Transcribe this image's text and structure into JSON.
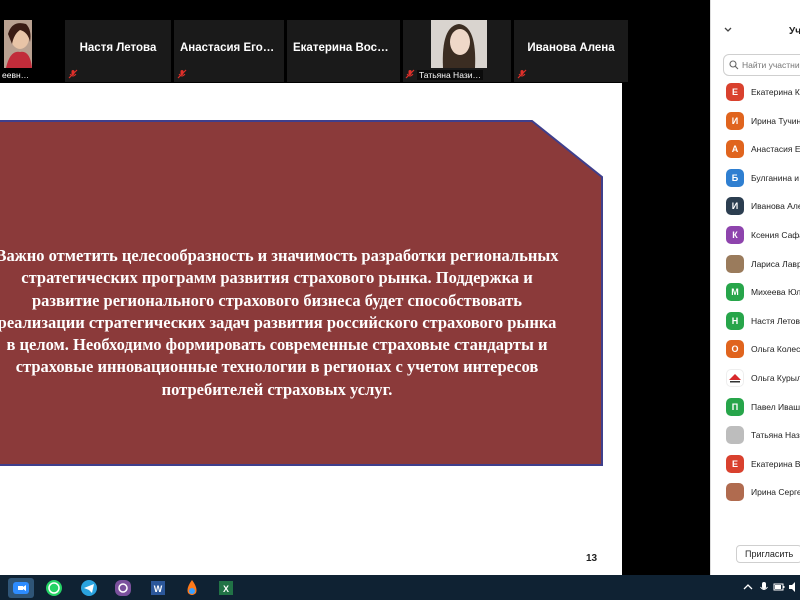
{
  "meeting": {
    "top_strip": {
      "tiles": [
        {
          "label": "еевн…"
        },
        {
          "name": "Настя Летова"
        },
        {
          "name": "Анастасия Егор…"
        },
        {
          "name": "Екатерина Вост…"
        },
        {
          "label": "Татьяна Нази…"
        },
        {
          "name": "Иванова Алена"
        }
      ]
    },
    "slide": {
      "text": "Важно отметить целесообразность и значимость разработки региональных стратегических программ развития страхового рынка. Поддержка и развитие регионального страхового бизнеса будет способствовать реализации стратегических задач развития российского страхового рынка в целом. Необходимо формировать современные страховые стандарты и страховые инновационные технологии в регионах с учетом интересов потребителей страховых услуг.",
      "page_number": "13",
      "colors": {
        "box_fill": "#8b3a3a",
        "box_border": "#3f3f8c",
        "accent": "#d8282b"
      }
    },
    "participants_panel": {
      "title": "Учас",
      "search_placeholder": "Найти участни",
      "invite_label": "Пригласить",
      "participants": [
        {
          "initial": "Е",
          "name": "Екатерина Ку",
          "color": "#d9412e"
        },
        {
          "initial": "И",
          "name": "Ирина Тучин",
          "color": "#e0641e"
        },
        {
          "initial": "А",
          "name": "Анастасия Ег",
          "color": "#e0641e"
        },
        {
          "initial": "Б",
          "name": "Булганина и",
          "color": "#2f7fd1"
        },
        {
          "initial": "И",
          "name": "Иванова Але",
          "color": "#2c3e50"
        },
        {
          "initial": "К",
          "name": "Ксения Сафа",
          "color": "#8e44ad"
        },
        {
          "initial": "",
          "name": "Лариса Лавр",
          "color": "#9a7b5c"
        },
        {
          "initial": "М",
          "name": "Михеева Юл",
          "color": "#27a54a"
        },
        {
          "initial": "Н",
          "name": "Настя Летова",
          "color": "#27a54a"
        },
        {
          "initial": "О",
          "name": "Ольга Колес",
          "color": "#e0641e"
        },
        {
          "initial": "",
          "name": "Ольга Курыл",
          "color": "#ffffff"
        },
        {
          "initial": "П",
          "name": "Павел Иваш",
          "color": "#27a54a"
        },
        {
          "initial": "",
          "name": "Татьяна Нази",
          "color": "#bdbdbd"
        },
        {
          "initial": "Е",
          "name": "Екатерина Во",
          "color": "#d9412e"
        },
        {
          "initial": "",
          "name": "Ирина Серге",
          "color": "#b06b4f"
        }
      ]
    }
  },
  "taskbar": {
    "icons": [
      "zoom-icon",
      "whatsapp-icon",
      "telegram-icon",
      "viber-icon",
      "word-icon",
      "paint-icon",
      "excel-icon"
    ],
    "tray": [
      "chevron-up-icon",
      "microphone-icon",
      "battery-icon",
      "volume-icon"
    ]
  }
}
